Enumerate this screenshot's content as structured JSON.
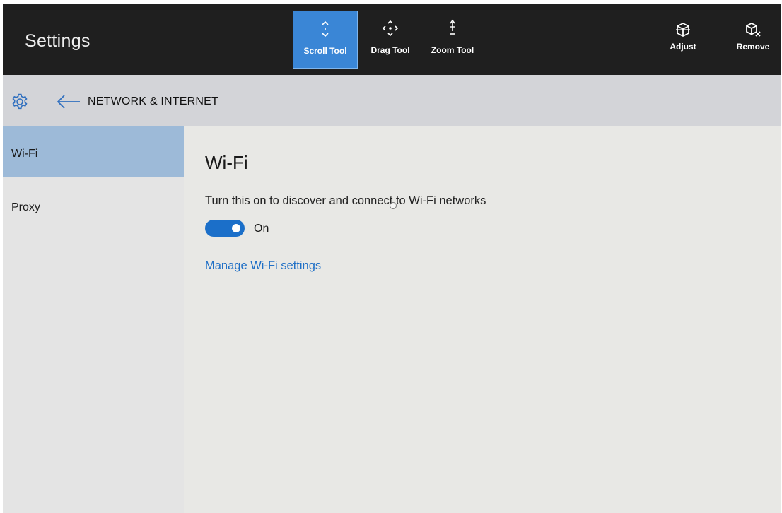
{
  "app": {
    "title": "Settings"
  },
  "toolbar": {
    "tools": [
      {
        "label": "Scroll Tool",
        "icon": "scroll-arrows-icon",
        "active": true
      },
      {
        "label": "Drag Tool",
        "icon": "drag-arrows-icon",
        "active": false
      },
      {
        "label": "Zoom Tool",
        "icon": "zoom-arrows-icon",
        "active": false
      }
    ],
    "actions": [
      {
        "label": "Adjust",
        "icon": "cube-adjust-icon"
      },
      {
        "label": "Remove",
        "icon": "cube-remove-icon"
      }
    ],
    "active_color": "#3a86d6"
  },
  "header": {
    "section_title": "NETWORK & INTERNET",
    "gear_icon": "gear-icon",
    "back_icon": "back-arrow-icon"
  },
  "sidebar": {
    "items": [
      {
        "label": "Wi-Fi",
        "selected": true
      },
      {
        "label": "Proxy",
        "selected": false
      }
    ],
    "selected_color": "#9dbad8"
  },
  "main": {
    "heading": "Wi-Fi",
    "description": "Turn this on to discover and connect to Wi-Fi networks",
    "toggle": {
      "state_label": "On",
      "on": true,
      "color": "#1b6fc9"
    },
    "manage_link": "Manage Wi-Fi settings",
    "link_color": "#1f6fc6"
  }
}
